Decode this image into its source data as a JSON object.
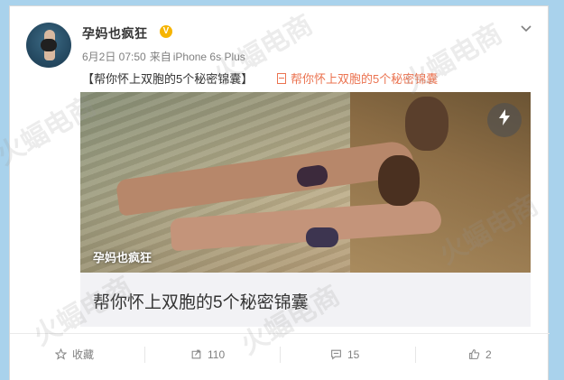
{
  "post": {
    "username": "孕妈也疯狂",
    "verified_badge": "V",
    "date": "6月2日 07:50",
    "source_prefix": "来自",
    "source_device": "iPhone 6s Plus",
    "text": "【帮你怀上双胞的5个秘密锦囊】",
    "link_text": "帮你怀上双胞的5个秘密锦囊",
    "menu_icon": "chevron-down-icon"
  },
  "article": {
    "cover_label": "孕妈也疯狂",
    "title": "帮你怀上双胞的5个秘密锦囊",
    "badge_icon": "lightning-icon"
  },
  "actions": {
    "favorite_label": "收藏",
    "repost_count": "110",
    "comment_count": "15",
    "like_count": "2"
  },
  "watermark": "火蝠电商",
  "colors": {
    "page_bg": "#a9d2ec",
    "link": "#eb7350",
    "verified": "#f6b400"
  }
}
